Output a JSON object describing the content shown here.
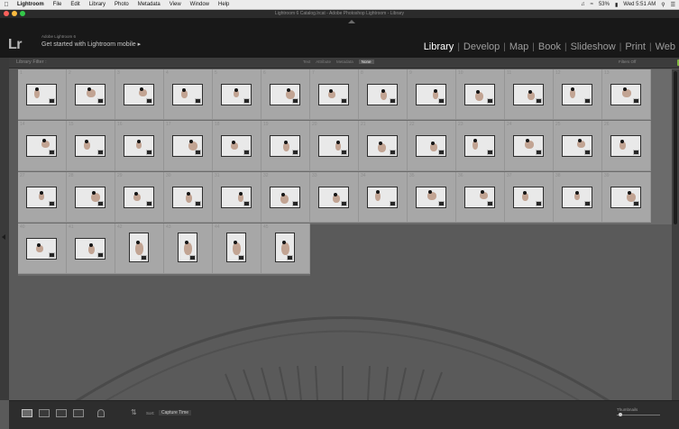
{
  "menubar": {
    "apple": "",
    "items": [
      "Lightroom",
      "File",
      "Edit",
      "Library",
      "Photo",
      "Metadata",
      "View",
      "Window",
      "Help"
    ],
    "battery": "53%",
    "clock": "Wed 5:51 AM"
  },
  "window": {
    "title": "Lightroom 6 Catalog.lrcat - Adobe Photoshop Lightroom - Library"
  },
  "identity": {
    "logo": "Lr",
    "small": "Adobe Lightroom 6",
    "main": "Get started with Lightroom mobile ▸"
  },
  "modules": {
    "library": "Library",
    "develop": "Develop",
    "map": "Map",
    "book": "Book",
    "slideshow": "Slideshow",
    "print": "Print",
    "web": "Web",
    "active": "Library"
  },
  "filter": {
    "label": "Library Filter :",
    "options": [
      "Text",
      "Attribute",
      "Metadata",
      "None"
    ],
    "selected": "None",
    "preset": "Filters Off"
  },
  "grid": {
    "photos": [
      {
        "n": "1",
        "o": "landscape"
      },
      {
        "n": "2",
        "o": "landscape"
      },
      {
        "n": "3",
        "o": "landscape"
      },
      {
        "n": "4",
        "o": "landscape"
      },
      {
        "n": "5",
        "o": "landscape"
      },
      {
        "n": "6",
        "o": "landscape"
      },
      {
        "n": "7",
        "o": "landscape"
      },
      {
        "n": "8",
        "o": "landscape"
      },
      {
        "n": "9",
        "o": "landscape"
      },
      {
        "n": "10",
        "o": "landscape"
      },
      {
        "n": "11",
        "o": "landscape"
      },
      {
        "n": "12",
        "o": "landscape"
      },
      {
        "n": "13",
        "o": "landscape"
      },
      {
        "n": "14",
        "o": "landscape"
      },
      {
        "n": "15",
        "o": "landscape"
      },
      {
        "n": "16",
        "o": "landscape"
      },
      {
        "n": "17",
        "o": "landscape"
      },
      {
        "n": "18",
        "o": "landscape"
      },
      {
        "n": "19",
        "o": "landscape"
      },
      {
        "n": "20",
        "o": "landscape"
      },
      {
        "n": "21",
        "o": "landscape"
      },
      {
        "n": "22",
        "o": "landscape"
      },
      {
        "n": "23",
        "o": "landscape"
      },
      {
        "n": "24",
        "o": "landscape"
      },
      {
        "n": "25",
        "o": "landscape"
      },
      {
        "n": "26",
        "o": "landscape"
      },
      {
        "n": "27",
        "o": "landscape"
      },
      {
        "n": "28",
        "o": "landscape"
      },
      {
        "n": "29",
        "o": "landscape"
      },
      {
        "n": "30",
        "o": "landscape"
      },
      {
        "n": "31",
        "o": "landscape"
      },
      {
        "n": "32",
        "o": "landscape"
      },
      {
        "n": "33",
        "o": "landscape"
      },
      {
        "n": "34",
        "o": "landscape"
      },
      {
        "n": "35",
        "o": "landscape"
      },
      {
        "n": "36",
        "o": "landscape"
      },
      {
        "n": "37",
        "o": "landscape"
      },
      {
        "n": "38",
        "o": "landscape"
      },
      {
        "n": "39",
        "o": "landscape"
      },
      {
        "n": "40",
        "o": "landscape"
      },
      {
        "n": "41",
        "o": "landscape"
      },
      {
        "n": "42",
        "o": "portrait"
      },
      {
        "n": "43",
        "o": "portrait"
      },
      {
        "n": "44",
        "o": "portrait"
      },
      {
        "n": "45",
        "o": "portrait"
      }
    ]
  },
  "toolbar": {
    "sort_label": "Sort:",
    "sort_value": "Capture Time",
    "thumbnails_label": "Thumbnails",
    "thumbnail_size": 0.05
  },
  "colors": {
    "accent": "#7fb63f",
    "panel": "#181818",
    "grid_bg": "#5a5a5a",
    "cell": "#a7a7a7"
  }
}
